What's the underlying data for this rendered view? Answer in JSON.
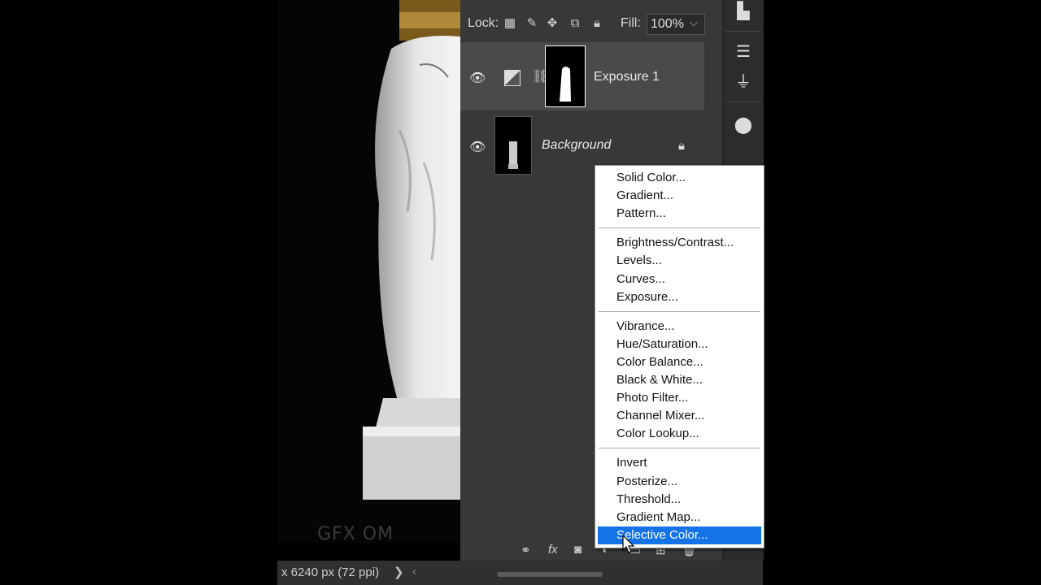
{
  "canvas": {
    "watermark": "GFX OM"
  },
  "statusbar": {
    "text": "x 6240 px (72 ppi)",
    "arrow": "❯",
    "arrow2": "‹"
  },
  "layers": {
    "lock_label": "Lock:",
    "fill_label": "Fill:",
    "fill_value": "100%",
    "items": [
      {
        "name": "Exposure 1",
        "visible": true,
        "selected": true
      },
      {
        "name": "Background",
        "visible": true,
        "locked": true
      }
    ]
  },
  "menu": {
    "groups": [
      [
        "Solid Color...",
        "Gradient...",
        "Pattern..."
      ],
      [
        "Brightness/Contrast...",
        "Levels...",
        "Curves...",
        "Exposure..."
      ],
      [
        "Vibrance...",
        "Hue/Saturation...",
        "Color Balance...",
        "Black & White...",
        "Photo Filter...",
        "Channel Mixer...",
        "Color Lookup..."
      ],
      [
        "Invert",
        "Posterize...",
        "Threshold...",
        "Gradient Map...",
        "Selective Color..."
      ]
    ],
    "selected": "Selective Color..."
  },
  "colors": {
    "panel": "#383838",
    "selection": "#1473e6",
    "layer_selected": "#4a4a4a"
  }
}
